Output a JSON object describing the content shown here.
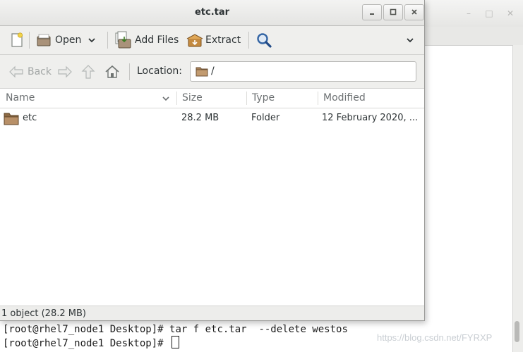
{
  "window": {
    "title": "etc.tar"
  },
  "toolbar": {
    "open_label": "Open",
    "add_files_label": "Add Files",
    "extract_label": "Extract"
  },
  "navigation": {
    "back_label": "Back",
    "location_label": "Location:",
    "location_value": "/"
  },
  "columns": {
    "name": "Name",
    "size": "Size",
    "type": "Type",
    "modified": "Modified"
  },
  "files": [
    {
      "name": "etc",
      "size": "28.2 MB",
      "type": "Folder",
      "modified": "12 February 2020, ..."
    }
  ],
  "status": {
    "text": "1 object (28.2 MB)"
  },
  "terminal": {
    "line1_prompt": "[root@rhel7_node1 Desktop]# ",
    "line1_command": "tar f etc.tar  --delete westos",
    "line2_prompt": "[root@rhel7_node1 Desktop]# "
  },
  "watermark": {
    "text": "https://blog.csdn.net/FYRXP"
  },
  "colors": {
    "folder": "#a9825a",
    "toolbar_bg": "#efefed",
    "disabled_text": "#a3a7a6",
    "search_icon": "#3465a4"
  },
  "icons": {
    "new": "new-archive-icon",
    "open": "open-archive-icon",
    "add_files": "add-files-icon",
    "extract": "extract-icon",
    "search": "search-icon",
    "back": "back-arrow-icon",
    "forward": "forward-arrow-icon",
    "up": "up-arrow-icon",
    "home": "home-icon",
    "folder": "folder-icon"
  }
}
